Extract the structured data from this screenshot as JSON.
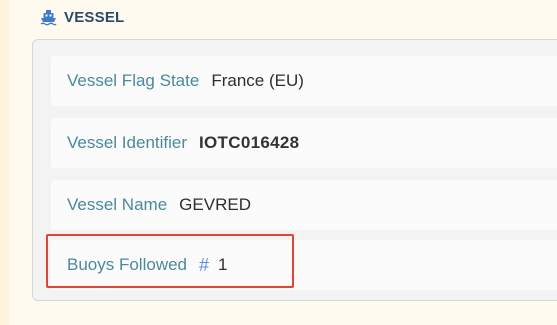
{
  "section": {
    "title": "VESSEL",
    "icon": "ship-icon"
  },
  "fields": [
    {
      "label": "Vessel Flag State",
      "value": "France (EU)"
    },
    {
      "label": "Vessel Identifier",
      "value": "IOTC016428"
    },
    {
      "label": "Vessel Name",
      "value": "GEVRED"
    },
    {
      "label": "Buoys Followed",
      "value": "1",
      "icon": "hash-icon"
    }
  ],
  "colors": {
    "label": "#4a8a9a",
    "title": "#2b4b66",
    "highlight_border": "#e0453c",
    "hash_icon": "#5b8ee0"
  }
}
